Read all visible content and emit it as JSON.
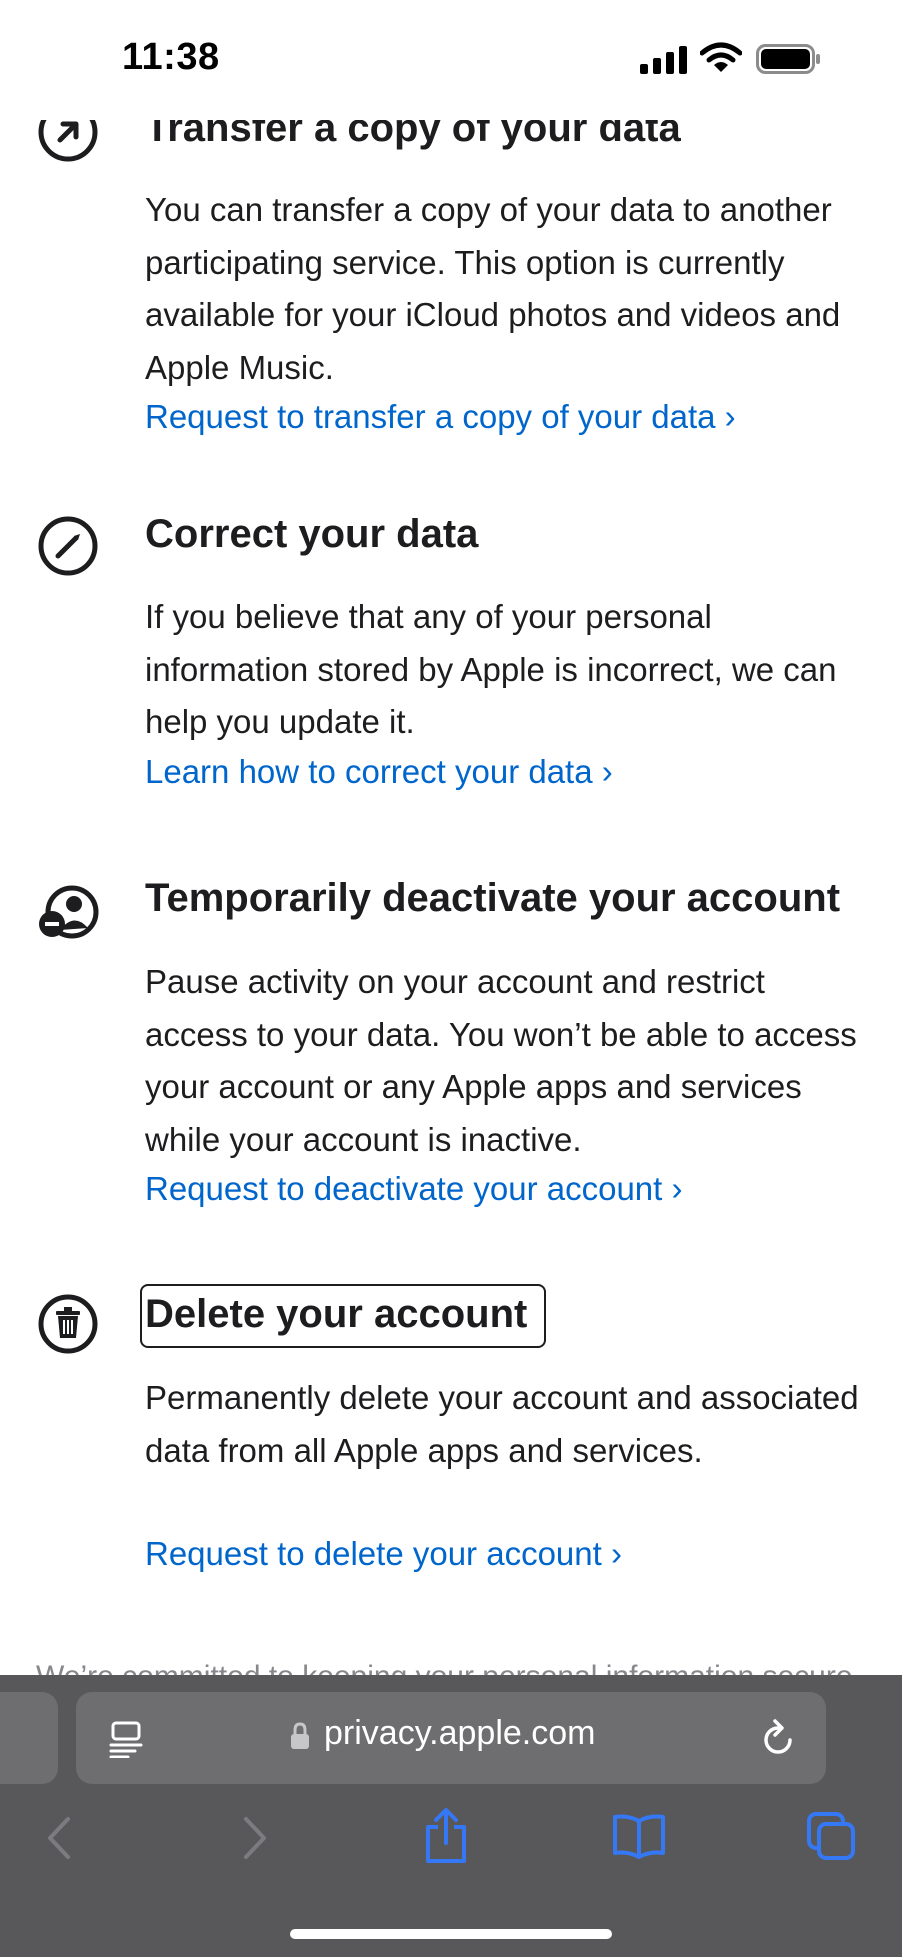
{
  "status_bar": {
    "time": "11:38"
  },
  "sections": [
    {
      "title": "Transfer a copy of your data",
      "body": "You can transfer a copy of your data to another participating service. This option is currently available for your iCloud photos and videos and Apple Music.",
      "link": "Request to transfer a copy of your data ›",
      "icon": "arrow-up-right-circle-icon"
    },
    {
      "title": "Correct your data",
      "body": "If you believe that any of your personal information stored by Apple is incorrect, we can help you update it.",
      "link": "Learn how to correct your data ›",
      "icon": "pencil-circle-icon"
    },
    {
      "title": "Temporarily deactivate your account",
      "body": "Pause activity on your account and restrict access to your data. You won’t be able to access your account or any Apple apps and services while your account is inactive.",
      "link": "Request to deactivate your account ›",
      "icon": "person-minus-icon"
    },
    {
      "title": "Delete your account",
      "body": "Permanently delete your account and associated data from all Apple apps and services.",
      "link": "Request to delete your account ›",
      "icon": "trash-circle-icon"
    }
  ],
  "footer_partial": "We’re committed to keeping your personal information secure",
  "browser": {
    "url": "privacy.apple.com",
    "colors": {
      "toolbar": "#58585a",
      "field": "#6e6e70",
      "accent": "#3478f6",
      "link": "#0066cc"
    }
  }
}
